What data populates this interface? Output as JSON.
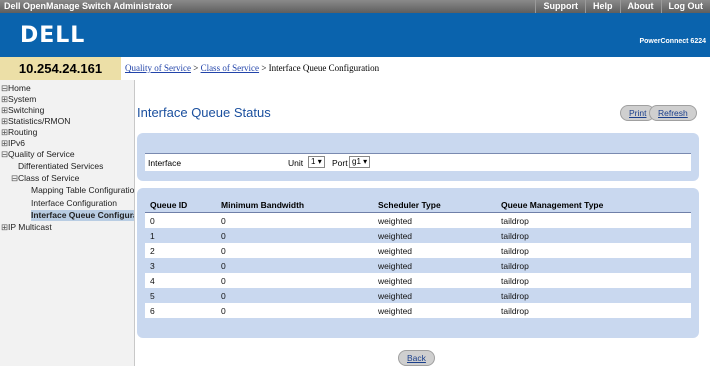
{
  "topbar": {
    "app_title": "Dell OpenManage Switch Administrator",
    "links": [
      "Support",
      "Help",
      "About",
      "Log Out"
    ]
  },
  "banner": {
    "logo": "DELL",
    "product": "PowerConnect 6224"
  },
  "ip_address": "10.254.24.161",
  "breadcrumb": {
    "part1": "Quality of Service",
    "sep": " > ",
    "part2": "Class of Service",
    "part3": "Interface Queue Configuration"
  },
  "sidebar": {
    "home": "Home",
    "system": "System",
    "switching": "Switching",
    "statistics": "Statistics/RMON",
    "routing": "Routing",
    "ipv6": "IPv6",
    "qos": "Quality of Service",
    "diffserv": "Differentiated Services",
    "cos": "Class of Service",
    "mapping": "Mapping Table Configuration",
    "interface_config": "Interface Configuration",
    "interface_queue": "Interface Queue Configuration",
    "multicast": "IP Multicast"
  },
  "page": {
    "title": "Interface Queue Status",
    "print_label": "Print",
    "refresh_label": "Refresh",
    "back_label": "Back"
  },
  "interface_row": {
    "label": "Interface",
    "unit_label": "Unit",
    "unit_value": "1",
    "port_label": "Port",
    "port_value": "g1"
  },
  "queue_table": {
    "headers": [
      "Queue ID",
      "Minimum Bandwidth",
      "Scheduler Type",
      "Queue Management Type"
    ],
    "rows": [
      [
        "0",
        "0",
        "weighted",
        "taildrop"
      ],
      [
        "1",
        "0",
        "weighted",
        "taildrop"
      ],
      [
        "2",
        "0",
        "weighted",
        "taildrop"
      ],
      [
        "3",
        "0",
        "weighted",
        "taildrop"
      ],
      [
        "4",
        "0",
        "weighted",
        "taildrop"
      ],
      [
        "5",
        "0",
        "weighted",
        "taildrop"
      ],
      [
        "6",
        "0",
        "weighted",
        "taildrop"
      ]
    ]
  },
  "colors": {
    "banner_blue": "#0a63ad",
    "ip_box": "#ecdfa7",
    "panel_blue": "#c9d8ef",
    "title_blue": "#1a4f9e"
  }
}
